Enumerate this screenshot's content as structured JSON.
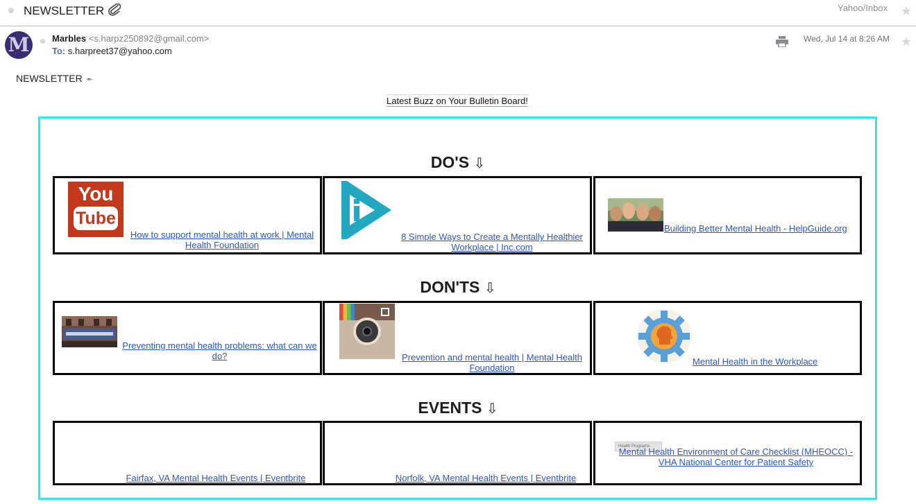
{
  "header": {
    "subject": "NEWSLETTER",
    "folder": "Yahoo/Inbox"
  },
  "message": {
    "sender_name": "Marbles",
    "sender_email": "<s.harpz250892@gmail.com>",
    "to_label": "To:",
    "to_address": "s.harpreet37@yahoo.com",
    "date": "Wed, Jul 14 at 8:26 AM",
    "avatar_letter": "M"
  },
  "body": {
    "title": "NEWSLETTER",
    "title_icon": "✒",
    "tagline": "Latest Buzz on Your Bulletin Board!",
    "accent_color": "#33e6ea",
    "link_color": "#2b56c9"
  },
  "sections": {
    "dos": {
      "heading": "DO'S",
      "arrow": "⇩",
      "items": [
        {
          "link": "How to support mental health at work | Mental Health Foundation",
          "thumb": "youtube-logo",
          "thumb_you": "You",
          "thumb_tube": "Tube"
        },
        {
          "link": "8 Simple Ways to Create a Mentally Healthier Workplace | Inc.com",
          "thumb": "play-logo"
        },
        {
          "link": "Building Better Mental Health - HelpGuide.org",
          "thumb": "group-photo"
        }
      ]
    },
    "donts": {
      "heading": "DON'TS",
      "arrow": "⇩",
      "items": [
        {
          "link": "Preventing mental health problems: what can we do?",
          "thumb": "sign-photo"
        },
        {
          "link": "Prevention and mental health | Mental Health Foundation",
          "thumb": "instagram-logo"
        },
        {
          "link": "Mental Health in the Workplace",
          "thumb": "gear-head-icon"
        }
      ]
    },
    "events": {
      "heading": "EVENTS",
      "arrow": "⇩",
      "items": [
        {
          "link": "Fairfax, VA Mental Health Events | Eventbrite"
        },
        {
          "link": "Norfolk, VA Mental Health Events | Eventbrite"
        },
        {
          "link": "Mental Health Environment of Care Checklist (MHEOCC) - VHA National Center for Patient Safety",
          "thumb": "health-programs-badge",
          "thumb_text": "Health Programs"
        }
      ]
    }
  }
}
